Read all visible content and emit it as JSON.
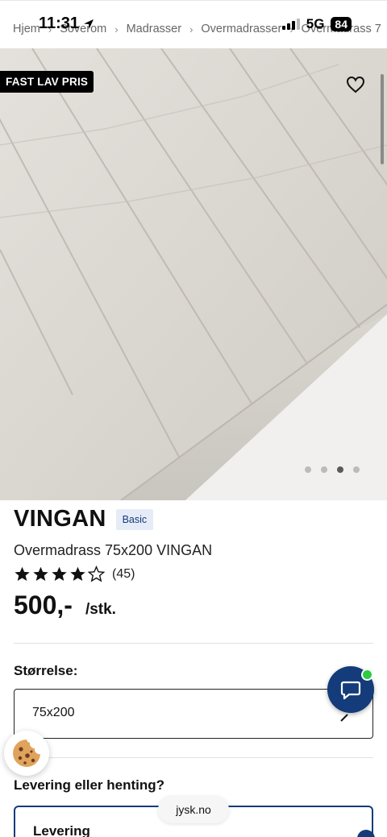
{
  "status_bar": {
    "time": "11:31",
    "network": "5G",
    "battery": "84"
  },
  "breadcrumb": {
    "items": [
      "Hjem",
      "Soverom",
      "Madrasser",
      "Overmadrasser",
      "Overmadrass 7"
    ]
  },
  "hero": {
    "badge": "FAST LAV PRIS",
    "carousel_index": 3,
    "carousel_count": 4
  },
  "product": {
    "name": "VINGAN",
    "tier_badge": "Basic",
    "subtitle": "Overmadrass 75x200 VINGAN",
    "rating_stars": 4,
    "rating_max": 5,
    "review_count": "(45)",
    "price": "500,-",
    "unit": "/stk."
  },
  "size": {
    "label": "Størrelse:",
    "selected": "75x200"
  },
  "delivery": {
    "label": "Levering eller henting?",
    "option": "Levering"
  },
  "browser": {
    "url": "jysk.no"
  },
  "colors": {
    "brand_blue": "#143b7a",
    "online_green": "#2ecc40",
    "badge_black": "#000000"
  },
  "icons": {
    "wishlist": "heart-icon",
    "chat": "chat-bubble-icon",
    "cookie": "cookie-icon",
    "chevron": "chevron-down-icon",
    "location": "location-arrow-icon"
  }
}
